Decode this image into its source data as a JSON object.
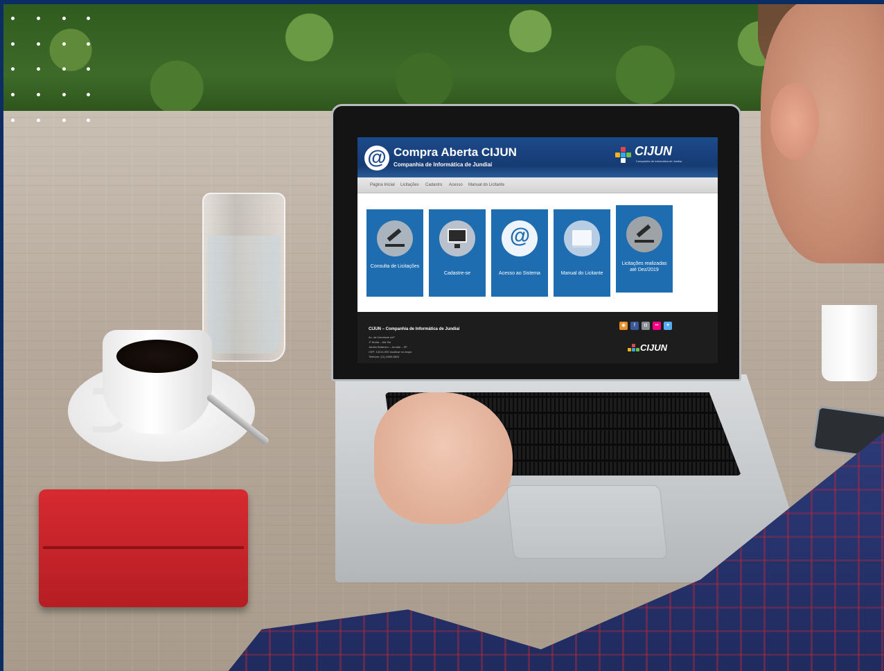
{
  "site": {
    "title": "Compra Aberta CIJUN",
    "subtitle": "Companhia de Informática de Jundiaí",
    "brand": "CIJUN",
    "brand_tagline": "Companhia de Informática de Jundiaí",
    "nav": [
      "Página Inicial",
      "Licitações",
      "Cadastro",
      "Acesso",
      "Manual do Licitante"
    ],
    "tiles": [
      {
        "label": "Consulta de Licitações",
        "icon": "gavel-icon"
      },
      {
        "label": "Cadastre-se",
        "icon": "monitor-icon"
      },
      {
        "label": "Acesso ao Sistema",
        "icon": "at-icon"
      },
      {
        "label": "Manual do Licitante",
        "icon": "book-icon"
      },
      {
        "label": "Licitações realizadas até Dez/2019",
        "icon": "gavel-icon"
      }
    ],
    "footer": {
      "title": "CIJUN – Companhia de Informática de Jundiaí",
      "lines": [
        "Av. da Liberdade s/nº",
        "1º Andar – Ala Sul",
        "Jardim Botânico – Jundiaí – SP",
        "CEP: 13214-900 localizar no mapa",
        "Telefone: (11) 4589-8824"
      ],
      "social": [
        "rss-icon",
        "facebook-icon",
        "instagram-icon",
        "flickr-icon",
        "twitter-icon"
      ]
    }
  },
  "colors": {
    "frame": "#0b2d63",
    "tile": "#1f6db1",
    "header": "#163b73",
    "footer": "#1d1d1d"
  }
}
